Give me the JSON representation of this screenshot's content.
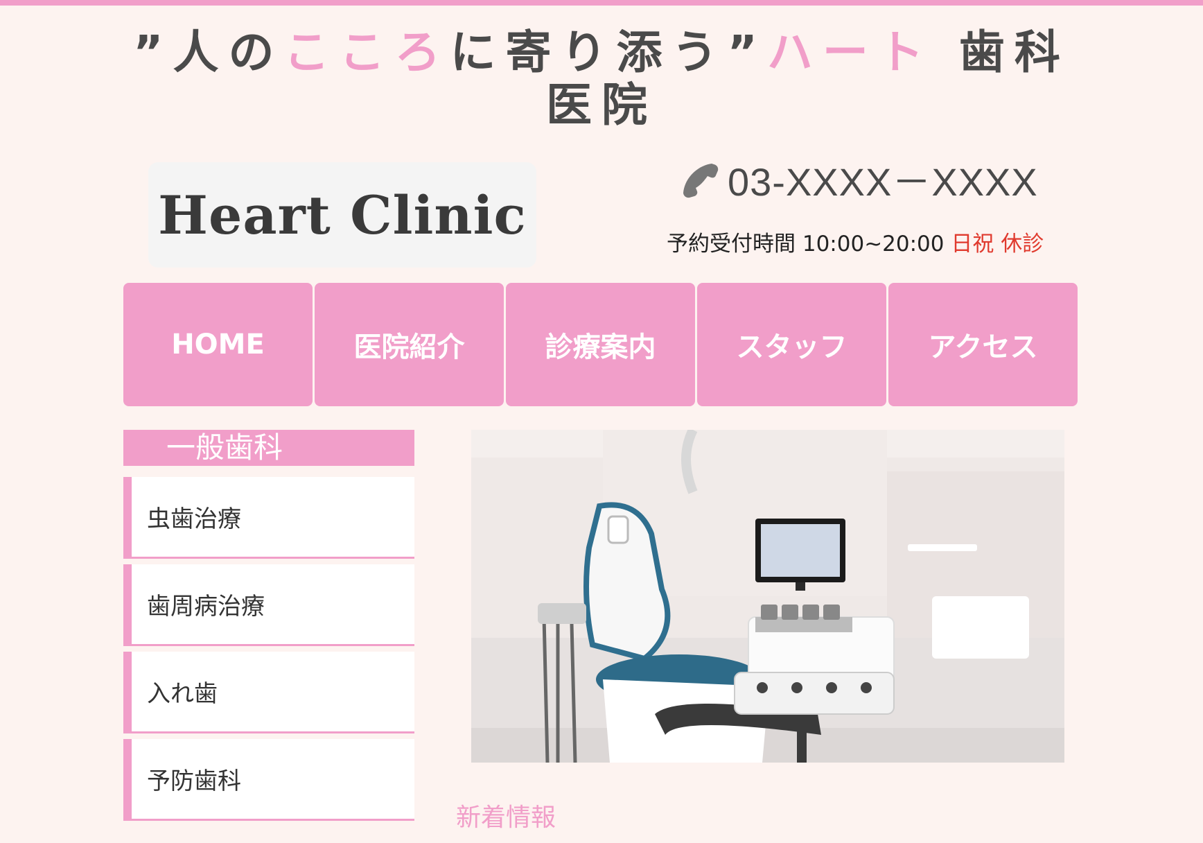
{
  "site": {
    "title_parts": [
      {
        "text": "”人の",
        "accent": false
      },
      {
        "text": "こころ",
        "accent": true
      },
      {
        "text": "に寄り添う”",
        "accent": false
      },
      {
        "text": "ハート",
        "accent": true
      },
      {
        "text": " 歯科医院",
        "accent": false
      }
    ],
    "logo_text": "Heart Clinic"
  },
  "contact": {
    "phone_icon": "phone-icon",
    "phone": "03-XXXX－XXXX",
    "hours_label": "予約受付時間 10:00~20:00",
    "closed": "日祝 休診"
  },
  "nav": {
    "items": [
      "HOME",
      "医院紹介",
      "診療案内",
      "スタッフ",
      "アクセス"
    ]
  },
  "sidebar": {
    "header": "一般歯科",
    "items": [
      "虫歯治療",
      "歯周病治療",
      "入れ歯",
      "予防歯科"
    ]
  },
  "main": {
    "photo": "dental-treatment-room-photo",
    "news_title": "新着情報"
  },
  "colors": {
    "accent": "#f19ec9",
    "background": "#fdf3f0",
    "closed_text": "#e03a2e",
    "text": "#4a4a4a"
  }
}
